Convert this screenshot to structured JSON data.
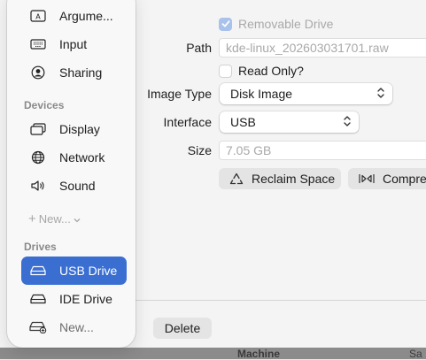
{
  "sidebar": {
    "top_items": [
      {
        "label": "Argume...",
        "icon": "argument-icon"
      },
      {
        "label": "Input",
        "icon": "keyboard-icon"
      },
      {
        "label": "Sharing",
        "icon": "person-circle-icon"
      }
    ],
    "devices_heading": "Devices",
    "devices": [
      {
        "label": "Display",
        "icon": "display-icon"
      },
      {
        "label": "Network",
        "icon": "globe-icon"
      },
      {
        "label": "Sound",
        "icon": "speaker-icon"
      }
    ],
    "add_new_label": "New...",
    "drives_heading": "Drives",
    "drives": [
      {
        "label": "USB Drive",
        "icon": "drive-icon",
        "selected": true
      },
      {
        "label": "IDE Drive",
        "icon": "drive-icon",
        "selected": false
      },
      {
        "label": "New...",
        "icon": "add-drive-icon",
        "selected": false
      }
    ]
  },
  "form": {
    "removable_label": "Removable Drive",
    "removable_checked": true,
    "path_label": "Path",
    "path_value": "kde-linux_202603031701.raw",
    "read_only_label": "Read Only?",
    "read_only_checked": false,
    "image_type_label": "Image Type",
    "image_type_value": "Disk Image",
    "interface_label": "Interface",
    "interface_value": "USB",
    "size_label": "Size",
    "size_placeholder": "7.05 GB",
    "reclaim_label": "Reclaim Space",
    "compress_label": "Compre"
  },
  "footer": {
    "delete_label": "Delete",
    "partial_below": "Machine",
    "partial_right": "Sa"
  },
  "colors": {
    "accent": "#3a6fd1",
    "sidebar_bg": "#f8f8f8",
    "content_bg": "#f4f4f4"
  }
}
